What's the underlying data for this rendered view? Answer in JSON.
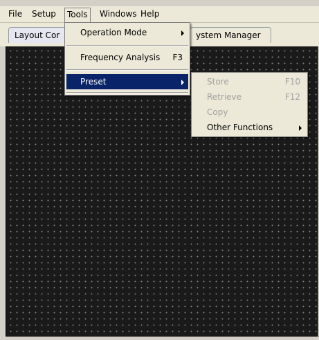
{
  "menubar": {
    "items": [
      {
        "label": "File"
      },
      {
        "label": "Setup"
      },
      {
        "label": "Tools"
      },
      {
        "label": "Windows"
      },
      {
        "label": "Help"
      }
    ]
  },
  "tabs": [
    {
      "label": "Layout Cor"
    },
    {
      "label": "ystem Manager"
    }
  ],
  "tools_menu": {
    "operation_mode": "Operation Mode",
    "frequency_analysis": "Frequency Analysis",
    "frequency_analysis_shortcut": "F3",
    "preset": "Preset"
  },
  "preset_submenu": {
    "store": "Store",
    "store_shortcut": "F10",
    "retrieve": "Retrieve",
    "retrieve_shortcut": "F12",
    "copy": "Copy",
    "other_functions": "Other Functions"
  }
}
